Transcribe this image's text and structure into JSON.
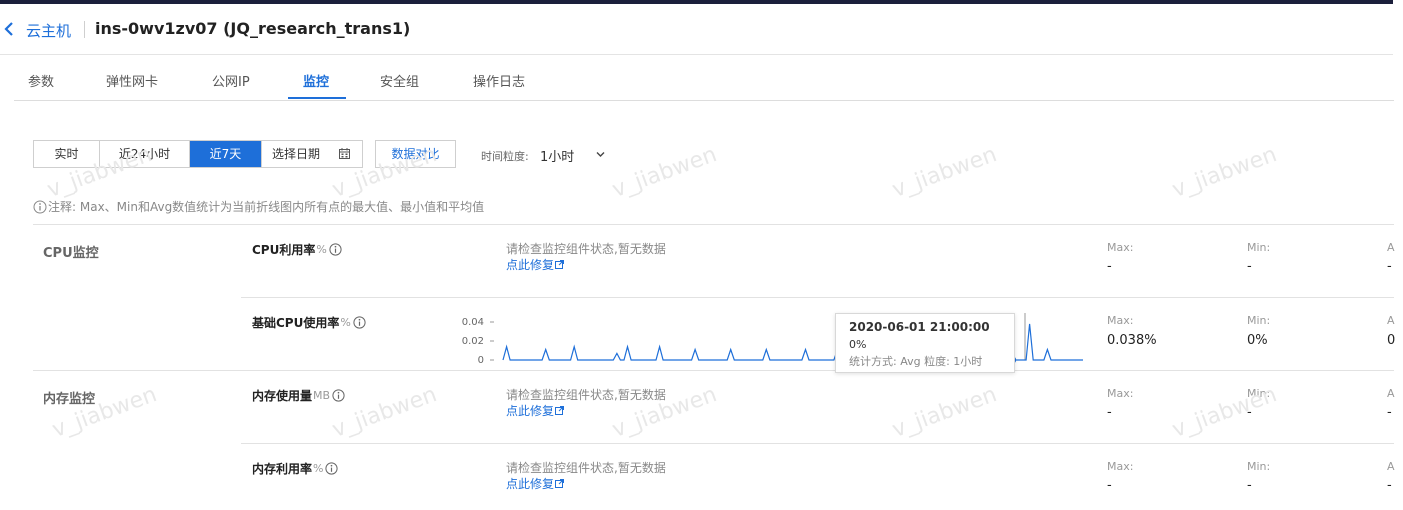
{
  "header": {
    "back_label": "云主机",
    "title": "ins-0wv1zv07  (JQ_research_trans1)"
  },
  "tabs": [
    {
      "label": "参数"
    },
    {
      "label": "弹性网卡"
    },
    {
      "label": "公网IP"
    },
    {
      "label": "监控",
      "active": true
    },
    {
      "label": "安全组"
    },
    {
      "label": "操作日志"
    }
  ],
  "toolbar": {
    "ranges": [
      "实时",
      "近24小时",
      "近7天"
    ],
    "active_range": "近7天",
    "date_picker_label": "选择日期",
    "compare_label": "数据对比",
    "granularity_label": "时间粒度:",
    "granularity_value": "1小时"
  },
  "note": "注释: Max、Min和Avg数值统计为当前折线图内所有点的最大值、最小值和平均值",
  "stat_labels": {
    "max": "Max:",
    "min": "Min:",
    "avg": "A"
  },
  "sections": {
    "cpu": "CPU监控",
    "memory": "内存监控"
  },
  "metrics": [
    {
      "name": "CPU利用率",
      "unit": "%",
      "status": "请检查监控组件状态,暂无数据",
      "fix_label": "点此修复",
      "max": "-",
      "min": "-",
      "avg": "-"
    },
    {
      "name": "基础CPU使用率",
      "unit": "%",
      "max": "0.038%",
      "min": "0%",
      "avg": "0"
    },
    {
      "name": "内存使用量",
      "unit": "MB",
      "status": "请检查监控组件状态,暂无数据",
      "fix_label": "点此修复",
      "max": "-",
      "min": "-",
      "avg": "-"
    },
    {
      "name": "内存利用率",
      "unit": "%",
      "status": "请检查监控组件状态,暂无数据",
      "fix_label": "点此修复",
      "max": "-",
      "min": "-",
      "avg": "-"
    }
  ],
  "tooltip": {
    "time": "2020-06-01 21:00:00",
    "value": "0%",
    "detail": "统计方式: Avg 粒度: 1小时"
  },
  "watermark": "v_jiabwen",
  "colors": {
    "accent": "#1e6fd9",
    "line": "#1e6fd9"
  },
  "chart_data": {
    "type": "line",
    "series": [
      {
        "values": [
          0,
          0.014,
          0,
          0,
          0,
          0,
          0,
          0,
          0,
          0,
          0,
          0,
          0.011,
          0,
          0,
          0,
          0,
          0,
          0,
          0,
          0.014,
          0,
          0,
          0,
          0,
          0,
          0,
          0,
          0,
          0,
          0,
          0,
          0.007,
          0,
          0,
          0.014,
          0,
          0,
          0,
          0,
          0,
          0,
          0,
          0,
          0.014,
          0,
          0,
          0,
          0,
          0,
          0,
          0,
          0,
          0,
          0.011,
          0,
          0,
          0,
          0,
          0,
          0,
          0,
          0,
          0,
          0.011,
          0,
          0,
          0,
          0,
          0,
          0,
          0,
          0,
          0,
          0.011,
          0,
          0,
          0,
          0,
          0,
          0,
          0,
          0,
          0,
          0,
          0.011,
          0,
          0,
          0,
          0,
          0,
          0,
          0,
          0,
          0.011,
          0,
          0,
          0,
          0,
          0,
          0,
          0,
          0,
          0.011,
          0,
          0,
          0,
          0,
          0,
          0,
          0,
          0,
          0,
          0.011,
          0,
          0,
          0,
          0,
          0,
          0,
          0,
          0,
          0,
          0.011,
          0,
          0,
          0,
          0,
          0,
          0,
          0,
          0,
          0,
          0.011,
          0,
          0,
          0,
          0,
          0,
          0.011,
          0,
          0,
          0,
          0,
          0,
          0,
          0,
          0,
          0.038,
          0,
          0,
          0,
          0,
          0.011,
          0,
          0,
          0,
          0,
          0,
          0,
          0,
          0,
          0,
          0
        ]
      }
    ],
    "yticks": [
      "0.04",
      "0.02",
      "0"
    ],
    "ylim": [
      0,
      0.04
    ],
    "hover_index": 143
  }
}
